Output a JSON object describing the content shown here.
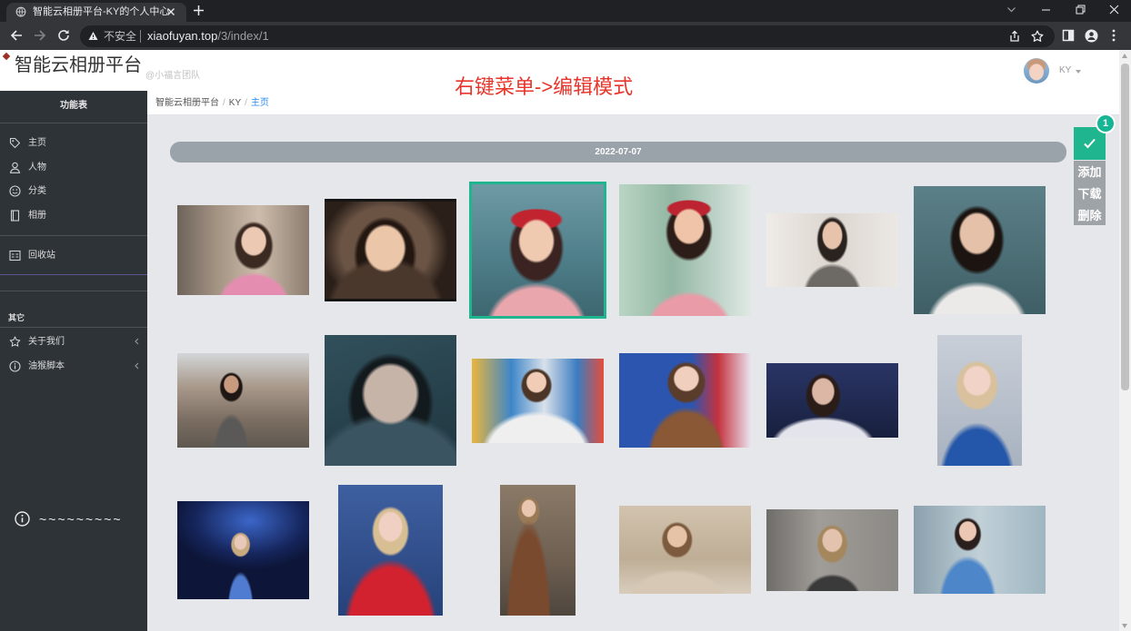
{
  "browser": {
    "tab_title": "智能云相册平台-KY的个人中心",
    "security_label": "不安全",
    "url_host": "xiaofuyan.top",
    "url_path": "/3/index/1"
  },
  "header": {
    "title": "智能云相册平台",
    "team": "@小福言团队",
    "hint": "右键菜单->编辑模式",
    "user": "KY"
  },
  "sidebar": {
    "title": "功能表",
    "items": [
      {
        "label": "主页",
        "icon": "tag-icon"
      },
      {
        "label": "人物",
        "icon": "person-icon"
      },
      {
        "label": "分类",
        "icon": "smile-icon"
      },
      {
        "label": "相册",
        "icon": "album-icon"
      }
    ],
    "trash": {
      "label": "回收站",
      "icon": "recycle-bin-icon"
    },
    "other_title": "其它",
    "other_items": [
      {
        "label": "关于我们",
        "icon": "star-icon"
      },
      {
        "label": "油猴脚本",
        "icon": "info-icon"
      }
    ],
    "footer_text": "~~~~~~~~~"
  },
  "breadcrumb": [
    "智能云相册平台",
    "KY",
    "主页"
  ],
  "gallery": {
    "date": "2022-07-07",
    "photos": [
      {
        "selected": false
      },
      {
        "selected": false
      },
      {
        "selected": true
      },
      {
        "selected": false
      },
      {
        "selected": false
      },
      {
        "selected": false
      },
      {
        "selected": false
      },
      {
        "selected": false
      },
      {
        "selected": false
      },
      {
        "selected": false
      },
      {
        "selected": false
      },
      {
        "selected": false
      },
      {
        "selected": false
      },
      {
        "selected": false
      },
      {
        "selected": false
      },
      {
        "selected": false
      },
      {
        "selected": false
      },
      {
        "selected": false
      }
    ]
  },
  "actions": {
    "selected_count": "1",
    "add": "添加",
    "download": "下载",
    "delete": "删除"
  },
  "colors": {
    "accent": "#1fb58f",
    "hint": "#e8352b",
    "link": "#2d8cf0",
    "sidebar": "#2e3338"
  }
}
